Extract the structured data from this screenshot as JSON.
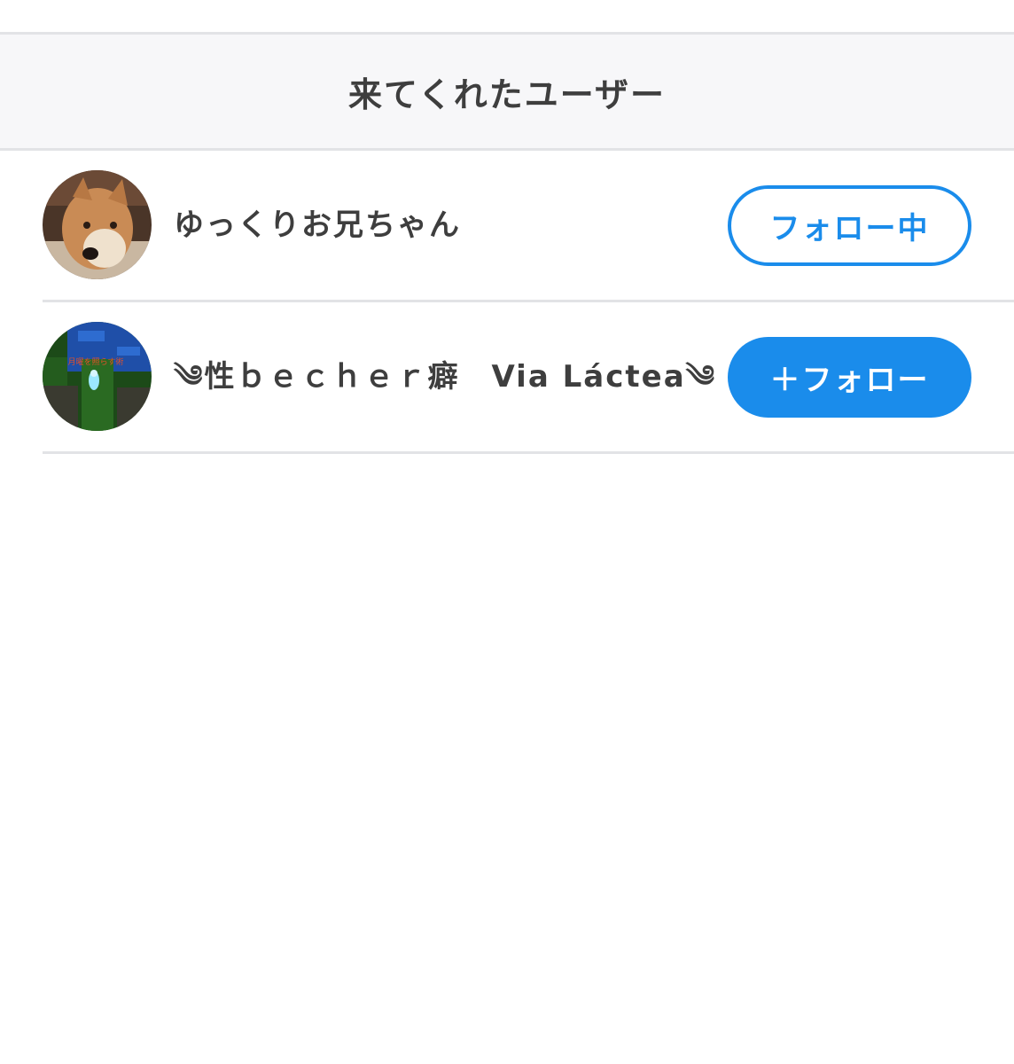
{
  "header": {
    "title": "来てくれたユーザー"
  },
  "users": [
    {
      "name": "ゆっくりお兄ちゃん",
      "avatar": "shiba-dog-photo",
      "button_label": "フォロー中",
      "button_state": "following"
    },
    {
      "name": "༄性ｂｅｃｈｅｒ癖　Via Láctea༄",
      "avatar": "game-scene-image",
      "avatar_text": "月曜を照らす術",
      "button_label": "＋フォロー",
      "button_state": "not-following"
    }
  ],
  "colors": {
    "accent": "#1a8ceb",
    "text": "#3e3e3e",
    "divider": "#e2e3e6",
    "header_bg": "#f7f7f9"
  }
}
